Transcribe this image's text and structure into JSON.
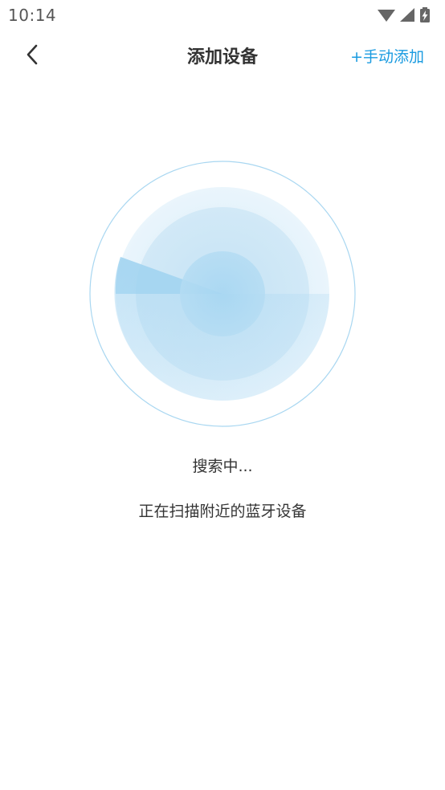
{
  "status_bar": {
    "time": "10:14",
    "icons": [
      "wifi-icon",
      "cellular-signal-icon",
      "battery-charging-icon"
    ]
  },
  "header": {
    "back_icon": "chevron-left-icon",
    "title": "添加设备",
    "manual_add_label": "+手动添加"
  },
  "scan": {
    "status_text": "搜索中...",
    "description": "正在扫描附近的蓝牙设备"
  },
  "colors": {
    "accent": "#1a9be0",
    "radar_ring": "#9fd3f0",
    "radar_fill": "#bfe0f5",
    "text_primary": "#333333"
  }
}
